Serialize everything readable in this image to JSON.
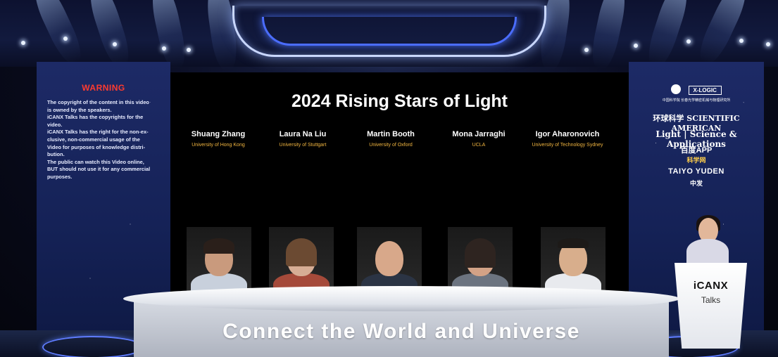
{
  "warning": {
    "title": "WARNING",
    "lines": [
      "The copyright of the content in this video",
      "is owned by the speakers.",
      "iCANX Talks has the copyrights for the",
      "video.",
      "iCANX Talks has the right for the non-ex-",
      "clusive, non-commercial usage of the",
      "Video for purposes of knowledge distri-",
      "bution.",
      "The public can watch this Video online,",
      "BUT should not use it for any commercial",
      "purposes."
    ]
  },
  "screen": {
    "title": "2024 Rising Stars of Light",
    "speakers": [
      {
        "name": "Shuang Zhang",
        "affiliation": "University of Hong Kong"
      },
      {
        "name": "Laura Na Liu",
        "affiliation": "University of Stuttgart"
      },
      {
        "name": "Martin Booth",
        "affiliation": "University of Oxford"
      },
      {
        "name": "Mona Jarraghi",
        "affiliation": "UCLA"
      },
      {
        "name": "Igor Aharonovich",
        "affiliation": "University of Technology Sydney"
      }
    ]
  },
  "sponsors": {
    "xlogo": "X-LOGIC",
    "cas": "中国科学院 长春光学精密机械与物理研究所",
    "huanqiu": "环球科学 SCIENTIFIC AMERICAN",
    "light": "Light | Science & Applications",
    "baidu": "百度APP",
    "kexue": "科学网",
    "taiyo": "TAIYO YUDEN",
    "zhongfa": "中发"
  },
  "desk": {
    "slogan": "Connect the World and Universe"
  },
  "podium": {
    "logo": "iCANX",
    "talks": "Talks"
  },
  "colors": {
    "warning": "#ff3b2f",
    "affiliation": "#f2b640",
    "panel": "#1d2a66"
  }
}
